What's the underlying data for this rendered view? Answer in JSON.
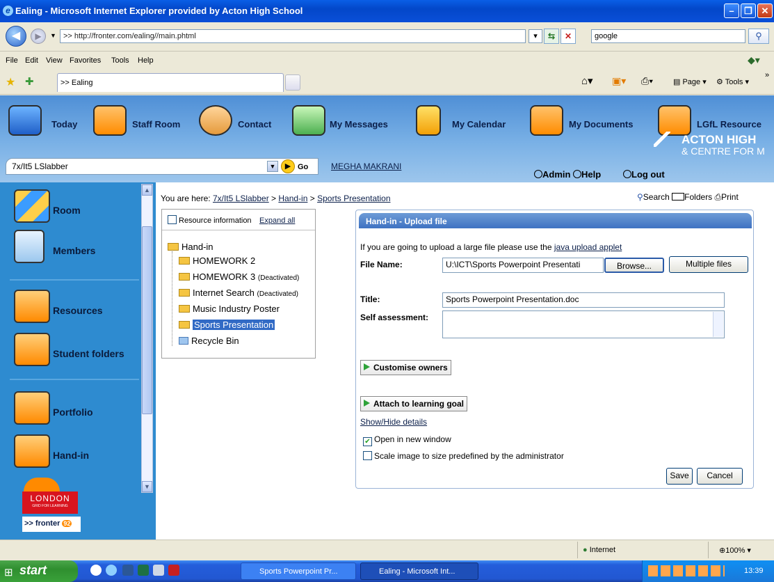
{
  "window": {
    "title": "Ealing - Microsoft Internet Explorer provided by Acton High School"
  },
  "address_bar": {
    "url": ">> http://fronter.com/ealing//main.phtml",
    "search": "google"
  },
  "menu": [
    "File",
    "Edit",
    "View",
    "Favorites",
    "Tools",
    "Help"
  ],
  "tab": {
    "title": ">> Ealing"
  },
  "command_bar": {
    "page": "Page",
    "tools": "Tools"
  },
  "top_nav": [
    {
      "label": "Today",
      "icon": "house-icon"
    },
    {
      "label": "Staff Room",
      "icon": "folder-glasses-icon"
    },
    {
      "label": "Contact",
      "icon": "people-icon"
    },
    {
      "label": "My Messages",
      "icon": "envelope-icon"
    },
    {
      "label": "My Calendar",
      "icon": "calendar-icon"
    },
    {
      "label": "My Documents",
      "icon": "folder-person-icon"
    },
    {
      "label": "LGfL Resource",
      "icon": "folder-glasses-icon"
    }
  ],
  "group_select": {
    "value": "7x/It5 LSlabber",
    "go": "Go"
  },
  "user": "MEGHA MAKRANI",
  "school_logo": {
    "line1": "ACTON HIGH",
    "line2": "& CENTRE FOR M"
  },
  "util_links": {
    "admin": "Admin",
    "help": "Help",
    "logout": "Log out"
  },
  "sidebar": [
    {
      "label": "Room"
    },
    {
      "label": "Members"
    },
    {
      "label": "Resources"
    },
    {
      "label": "Student folders"
    },
    {
      "label": "Portfolio"
    },
    {
      "label": "Hand-in"
    }
  ],
  "sidebar_logos": {
    "london": "LONDON",
    "london_sub": "GRID FOR LEARNING",
    "fronter": ">> fronter",
    "fronter_ver": "92"
  },
  "breadcrumb": {
    "prefix": "You are here:",
    "items": [
      "7x/It5 LSlabber",
      "Hand-in",
      "Sports Presentation"
    ]
  },
  "tools": {
    "search": "Search",
    "folders": "Folders",
    "print": "Print"
  },
  "tree": {
    "resource_info": "Resource information",
    "expand_all": "Expand all",
    "root": "Hand-in",
    "items": [
      {
        "label": "HOMEWORK 2",
        "note": ""
      },
      {
        "label": "HOMEWORK 3",
        "note": "(Deactivated)"
      },
      {
        "label": "Internet Search",
        "note": "(Deactivated)"
      },
      {
        "label": "Music Industry Poster",
        "note": ""
      },
      {
        "label": "Sports Presentation",
        "note": ""
      },
      {
        "label": "Recycle Bin",
        "note": ""
      }
    ]
  },
  "upload": {
    "title": "Hand-in - Upload file",
    "hint_prefix": "If you are going to upload a large file please use the",
    "hint_link": "java upload applet",
    "file_label": "File Name:",
    "file_value": "U:\\ICT\\Sports Powerpoint Presentati",
    "browse": "Browse...",
    "multiple": "Multiple files",
    "title_label": "Title:",
    "title_value": "Sports Powerpoint Presentation.doc",
    "self_label": "Self assessment:",
    "customise": "Customise owners",
    "attach": "Attach to learning goal",
    "show_hide": "Show/Hide details",
    "open_new": "Open in new window",
    "open_new_checked": true,
    "scale": "Scale image to size predefined by the administrator",
    "scale_checked": false,
    "save": "Save",
    "cancel": "Cancel"
  },
  "status_bar": {
    "zone": "Internet",
    "zoom": "100%"
  },
  "taskbar": {
    "start": "start",
    "tasks": [
      "Sports Powerpoint Pr...",
      "Ealing - Microsoft Int..."
    ],
    "clock": "13:39"
  }
}
